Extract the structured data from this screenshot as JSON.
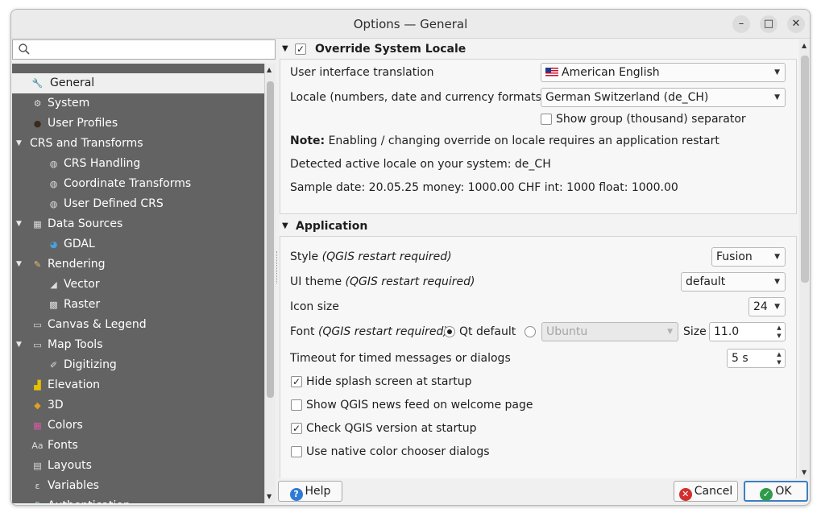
{
  "window": {
    "title": "Options — General"
  },
  "search": {
    "placeholder": ""
  },
  "sidebar": {
    "items": [
      {
        "label": "General",
        "icon": "wrench-icon",
        "selected": true
      },
      {
        "label": "System",
        "icon": "gear-icon"
      },
      {
        "label": "User Profiles",
        "icon": "user-icon"
      },
      {
        "label": "CRS and Transforms",
        "icon": "",
        "expandable": true
      },
      {
        "label": "CRS Handling",
        "icon": "globe-gear-icon"
      },
      {
        "label": "Coordinate Transforms",
        "icon": "globe-transform-icon"
      },
      {
        "label": "User Defined CRS",
        "icon": "globe-user-icon"
      },
      {
        "label": "Data Sources",
        "icon": "table-icon",
        "expandable": true
      },
      {
        "label": "GDAL",
        "icon": "gdal-globe-icon"
      },
      {
        "label": "Rendering",
        "icon": "paintbrush-icon",
        "expandable": true
      },
      {
        "label": "Vector",
        "icon": "vector-icon"
      },
      {
        "label": "Raster",
        "icon": "raster-icon"
      },
      {
        "label": "Canvas & Legend",
        "icon": "canvas-icon"
      },
      {
        "label": "Map Tools",
        "icon": "map-tools-icon",
        "expandable": true
      },
      {
        "label": "Digitizing",
        "icon": "digitizing-icon"
      },
      {
        "label": "Elevation",
        "icon": "elevation-icon"
      },
      {
        "label": "3D",
        "icon": "cube-icon"
      },
      {
        "label": "Colors",
        "icon": "color-palette-icon"
      },
      {
        "label": "Fonts",
        "icon": "font-icon"
      },
      {
        "label": "Layouts",
        "icon": "layout-icon"
      },
      {
        "label": "Variables",
        "icon": "variables-icon"
      },
      {
        "label": "Authentication",
        "icon": "lock-icon"
      }
    ]
  },
  "locale": {
    "group_title": "Override System Locale",
    "group_checked": true,
    "ui_translation_label": "User interface translation",
    "ui_translation_value": "American English",
    "locale_label": "Locale (numbers, date and currency formats)",
    "locale_value": "German Switzerland (de_CH)",
    "group_separator_label": "Show group (thousand) separator",
    "group_separator_checked": false,
    "note_bold": "Note:",
    "note_text": " Enabling / changing override on locale requires an application restart",
    "detected": "Detected active locale on your system: de_CH",
    "sample": "Sample date: 20.05.25 money: 1000.00 CHF int: 1000 float: 1000.00"
  },
  "application": {
    "group_title": "Application",
    "style_label": "Style ",
    "style_hint": "(QGIS restart required)",
    "style_value": "Fusion",
    "theme_label": "UI theme ",
    "theme_hint": "(QGIS restart required)",
    "theme_value": "default",
    "icon_size_label": "Icon size",
    "icon_size_value": "24",
    "font_label": "Font ",
    "font_hint": "(QGIS restart required)",
    "font_qt_default": "Qt default",
    "font_qt_default_selected": true,
    "font_custom_value": "Ubuntu",
    "size_label": "Size",
    "size_value": "11.0",
    "timeout_label": "Timeout for timed messages or dialogs",
    "timeout_value": "5 s",
    "hide_splash_label": "Hide splash screen at startup",
    "hide_splash_checked": true,
    "news_feed_label": "Show QGIS news feed on welcome page",
    "news_feed_checked": false,
    "check_version_label": "Check QGIS version at startup",
    "check_version_checked": true,
    "native_color_label": "Use native color chooser dialogs",
    "native_color_checked": false
  },
  "buttons": {
    "help": "Help",
    "cancel": "Cancel",
    "ok": "OK"
  },
  "colors": {
    "sidebar_bg": "#636363",
    "default_button_border": "#3d7fc1",
    "help_icon": "#2e7bd4",
    "cancel_icon": "#d32f2f",
    "ok_icon": "#2e9b4a"
  }
}
